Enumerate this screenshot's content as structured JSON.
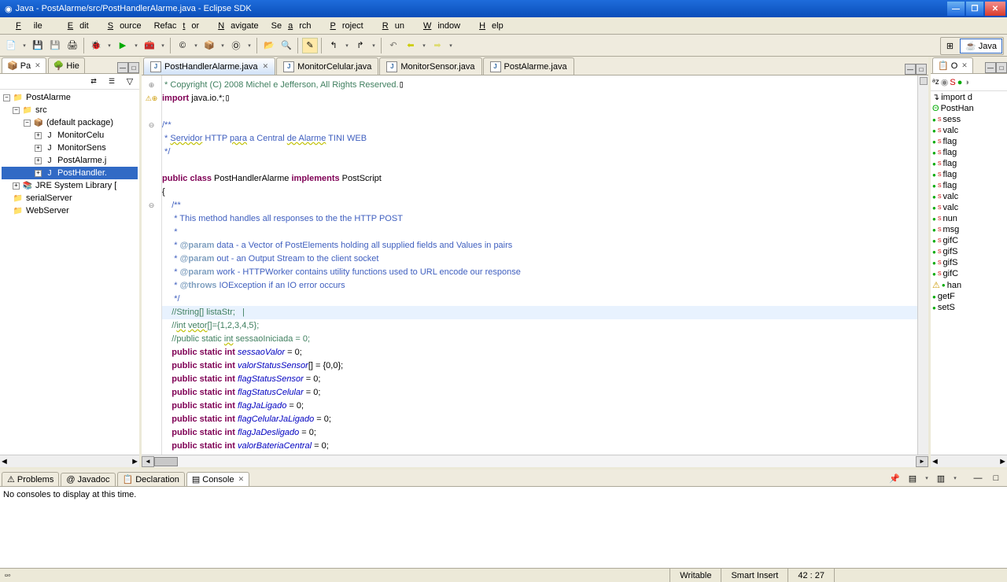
{
  "window": {
    "title": "Java - PostAlarme/src/PostHandlerAlarme.java - Eclipse SDK"
  },
  "menu": {
    "file": "File",
    "edit": "Edit",
    "source": "Source",
    "refactor": "Refactor",
    "navigate": "Navigate",
    "search": "Search",
    "project": "Project",
    "run": "Run",
    "window": "Window",
    "help": "Help"
  },
  "perspective": {
    "java": "Java"
  },
  "left_tabs": {
    "pa": "Pa",
    "hie": "Hie"
  },
  "package_explorer": {
    "project": "PostAlarme",
    "src": "src",
    "pkg": "(default package)",
    "files": [
      "MonitorCelu",
      "MonitorSens",
      "PostAlarme.j",
      "PostHandler."
    ],
    "jre": "JRE System Library [",
    "folders": [
      "serialServer",
      "WebServer"
    ]
  },
  "editor_tabs": [
    "PostHandlerAlarme.java",
    "MonitorCelular.java",
    "MonitorSensor.java",
    "PostAlarme.java"
  ],
  "outline_tab": "O",
  "outline": {
    "items": [
      "import d",
      "PostHan",
      "sess",
      "valc",
      "flag",
      "flag",
      "flag",
      "flag",
      "flag",
      "valc",
      "valc",
      "nun",
      "msg",
      "gifC",
      "gifS",
      "gifS",
      "gifC",
      "han",
      "getF",
      "setS"
    ]
  },
  "bottom_tabs": {
    "problems": "Problems",
    "javadoc": "Javadoc",
    "declaration": "Declaration",
    "console": "Console"
  },
  "console_msg": "No consoles to display at this time.",
  "status": {
    "writable": "Writable",
    "insert": "Smart Insert",
    "pos": "42 : 27"
  },
  "code": {
    "l1": " * Copyright (C) 2008 Michel e Jefferson, All Rights Reserved.",
    "l2a": "import",
    "l2b": " java.io.*;",
    "l3": "/**",
    "l4a": " * ",
    "l4b": "Servidor",
    "l4c": " HTTP ",
    "l4d": "para",
    "l4e": " a Central ",
    "l4f": "de Alarme",
    "l4g": " TINI WEB",
    "l5": " */",
    "l6a": "public class",
    "l6b": " PostHandlerAlarme ",
    "l6c": "implements",
    "l6d": " PostScript",
    "l7": "{",
    "l8": "    /**",
    "l9": "     * This method handles all responses to the the HTTP POST",
    "l10": "     *",
    "l11a": "     * ",
    "l11b": "@param",
    "l11c": " data - a Vector of PostElements holding all supplied fields and Values in pairs",
    "l12a": "     * ",
    "l12b": "@param",
    "l12c": " out - an Output Stream to the client socket",
    "l13a": "     * ",
    "l13b": "@param",
    "l13c": " work - HTTPWorker contains utility functions used to URL encode our response",
    "l14a": "     * ",
    "l14b": "@throws",
    "l14c": " IOException if an IO error occurs",
    "l15": "     */",
    "l16": "    //String[] listaStr;   |",
    "l17a": "    //",
    "l17b": "int",
    "l17c": " ",
    "l17d": "vetor",
    "l17e": "[]={1,2,3,4,5};",
    "l18a": "    //public static ",
    "l18b": "int",
    "l18c": " sessaoIniciada = 0;",
    "l19a": "    public static int",
    "l19b": " sessaoValor",
    "l19c": " = 0;",
    "l20a": "    public static int",
    "l20b": " valorStatusSensor",
    "l20c": "[] = {0,0};",
    "l21a": "    public static int",
    "l21b": " flagStatusSensor",
    "l21c": " = 0;",
    "l22a": "    public static int",
    "l22b": " flagStatusCelular",
    "l22c": " = 0;",
    "l23a": "    public static int",
    "l23b": " flagJaLigado",
    "l23c": " = 0;",
    "l24a": "    public static int",
    "l24b": " flagCelularJaLigado",
    "l24c": " = 0;",
    "l25a": "    public static int",
    "l25b": " flagJaDesligado",
    "l25c": " = 0;",
    "l26a": "    public static int",
    "l26b": " valorBateriaCentral",
    "l26c": " = 0;"
  }
}
